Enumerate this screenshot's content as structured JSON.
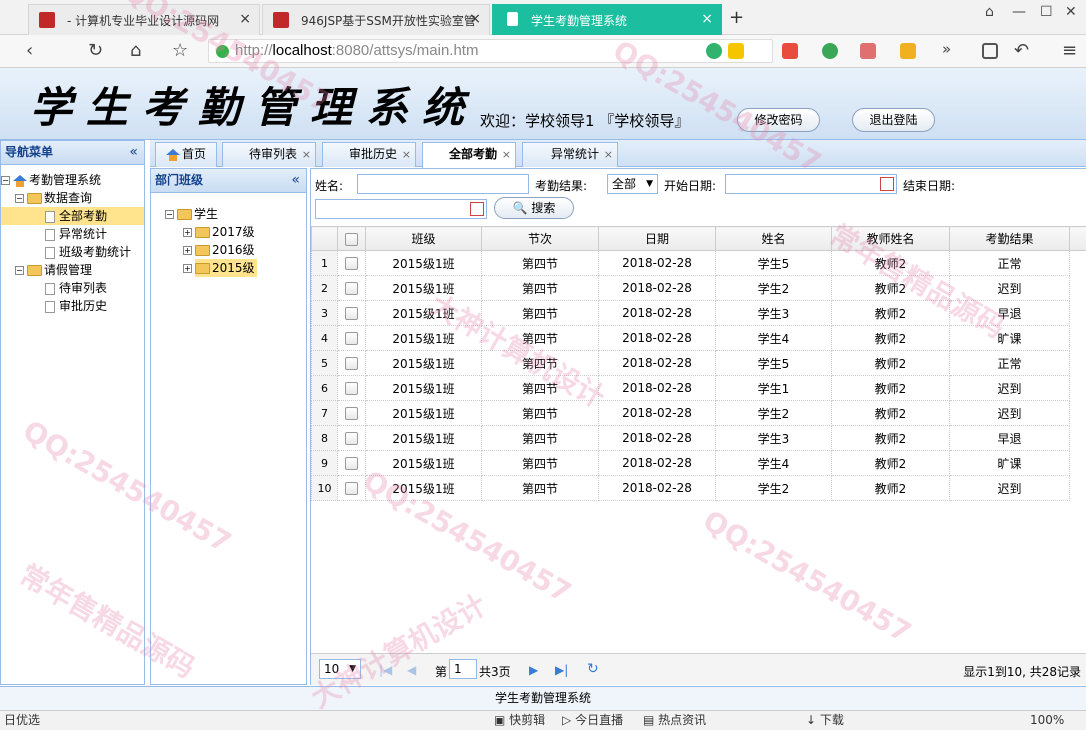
{
  "browser": {
    "tabs": [
      {
        "label": "- 计算机专业毕业设计源码网"
      },
      {
        "label": "946JSP基于SSM开放性实验室管"
      },
      {
        "label": "学生考勤管理系统"
      }
    ],
    "url_scheme": "http://",
    "url_host": "localhost",
    "url_rest": ":8080/attsys/main.htm"
  },
  "header": {
    "title": "学生考勤管理系统",
    "welcome": "欢迎：学校领导1 『学校领导』",
    "change_pwd": "修改密码",
    "logout": "退出登陆"
  },
  "nav": {
    "title": "导航菜单",
    "root": "考勤管理系统",
    "groups": [
      {
        "label": "数据查询",
        "items": [
          "全部考勤",
          "异常统计",
          "班级考勤统计"
        ]
      },
      {
        "label": "请假管理",
        "items": [
          "待审列表",
          "审批历史"
        ]
      }
    ]
  },
  "tabs": [
    "首页",
    "待审列表",
    "审批历史",
    "全部考勤",
    "异常统计"
  ],
  "dept": {
    "title": "部门班级",
    "root": "学生",
    "children": [
      "2017级",
      "2016级",
      "2015级"
    ]
  },
  "search": {
    "name_label": "姓名:",
    "result_label": "考勤结果:",
    "result_value": "全部",
    "start_label": "开始日期:",
    "end_label": "结束日期:",
    "button": "搜索"
  },
  "grid": {
    "columns": [
      "班级",
      "节次",
      "日期",
      "姓名",
      "教师姓名",
      "考勤结果"
    ],
    "rows": [
      [
        "2015级1班",
        "第四节",
        "2018-02-28",
        "学生5",
        "教师2",
        "正常"
      ],
      [
        "2015级1班",
        "第四节",
        "2018-02-28",
        "学生2",
        "教师2",
        "迟到"
      ],
      [
        "2015级1班",
        "第四节",
        "2018-02-28",
        "学生3",
        "教师2",
        "早退"
      ],
      [
        "2015级1班",
        "第四节",
        "2018-02-28",
        "学生4",
        "教师2",
        "旷课"
      ],
      [
        "2015级1班",
        "第四节",
        "2018-02-28",
        "学生5",
        "教师2",
        "正常"
      ],
      [
        "2015级1班",
        "第四节",
        "2018-02-28",
        "学生1",
        "教师2",
        "迟到"
      ],
      [
        "2015级1班",
        "第四节",
        "2018-02-28",
        "学生2",
        "教师2",
        "迟到"
      ],
      [
        "2015级1班",
        "第四节",
        "2018-02-28",
        "学生3",
        "教师2",
        "早退"
      ],
      [
        "2015级1班",
        "第四节",
        "2018-02-28",
        "学生4",
        "教师2",
        "旷课"
      ],
      [
        "2015级1班",
        "第四节",
        "2018-02-28",
        "学生2",
        "教师2",
        "迟到"
      ]
    ]
  },
  "pager": {
    "page_size": "10",
    "page_prefix": "第",
    "page_value": "1",
    "page_total": "共3页",
    "summary": "显示1到10, 共28记录"
  },
  "footer": "学生考勤管理系统",
  "statusbar": [
    "日优选",
    "快剪辑",
    "今日直播",
    "热点资讯",
    "下载",
    "100%"
  ],
  "watermarks": [
    "QQ:254540457",
    "大神计算机设计",
    "常年售精品源码"
  ],
  "colors": {
    "accent": "#1bbfa0",
    "border": "#99bbe8",
    "selected": "#ffe48d"
  }
}
